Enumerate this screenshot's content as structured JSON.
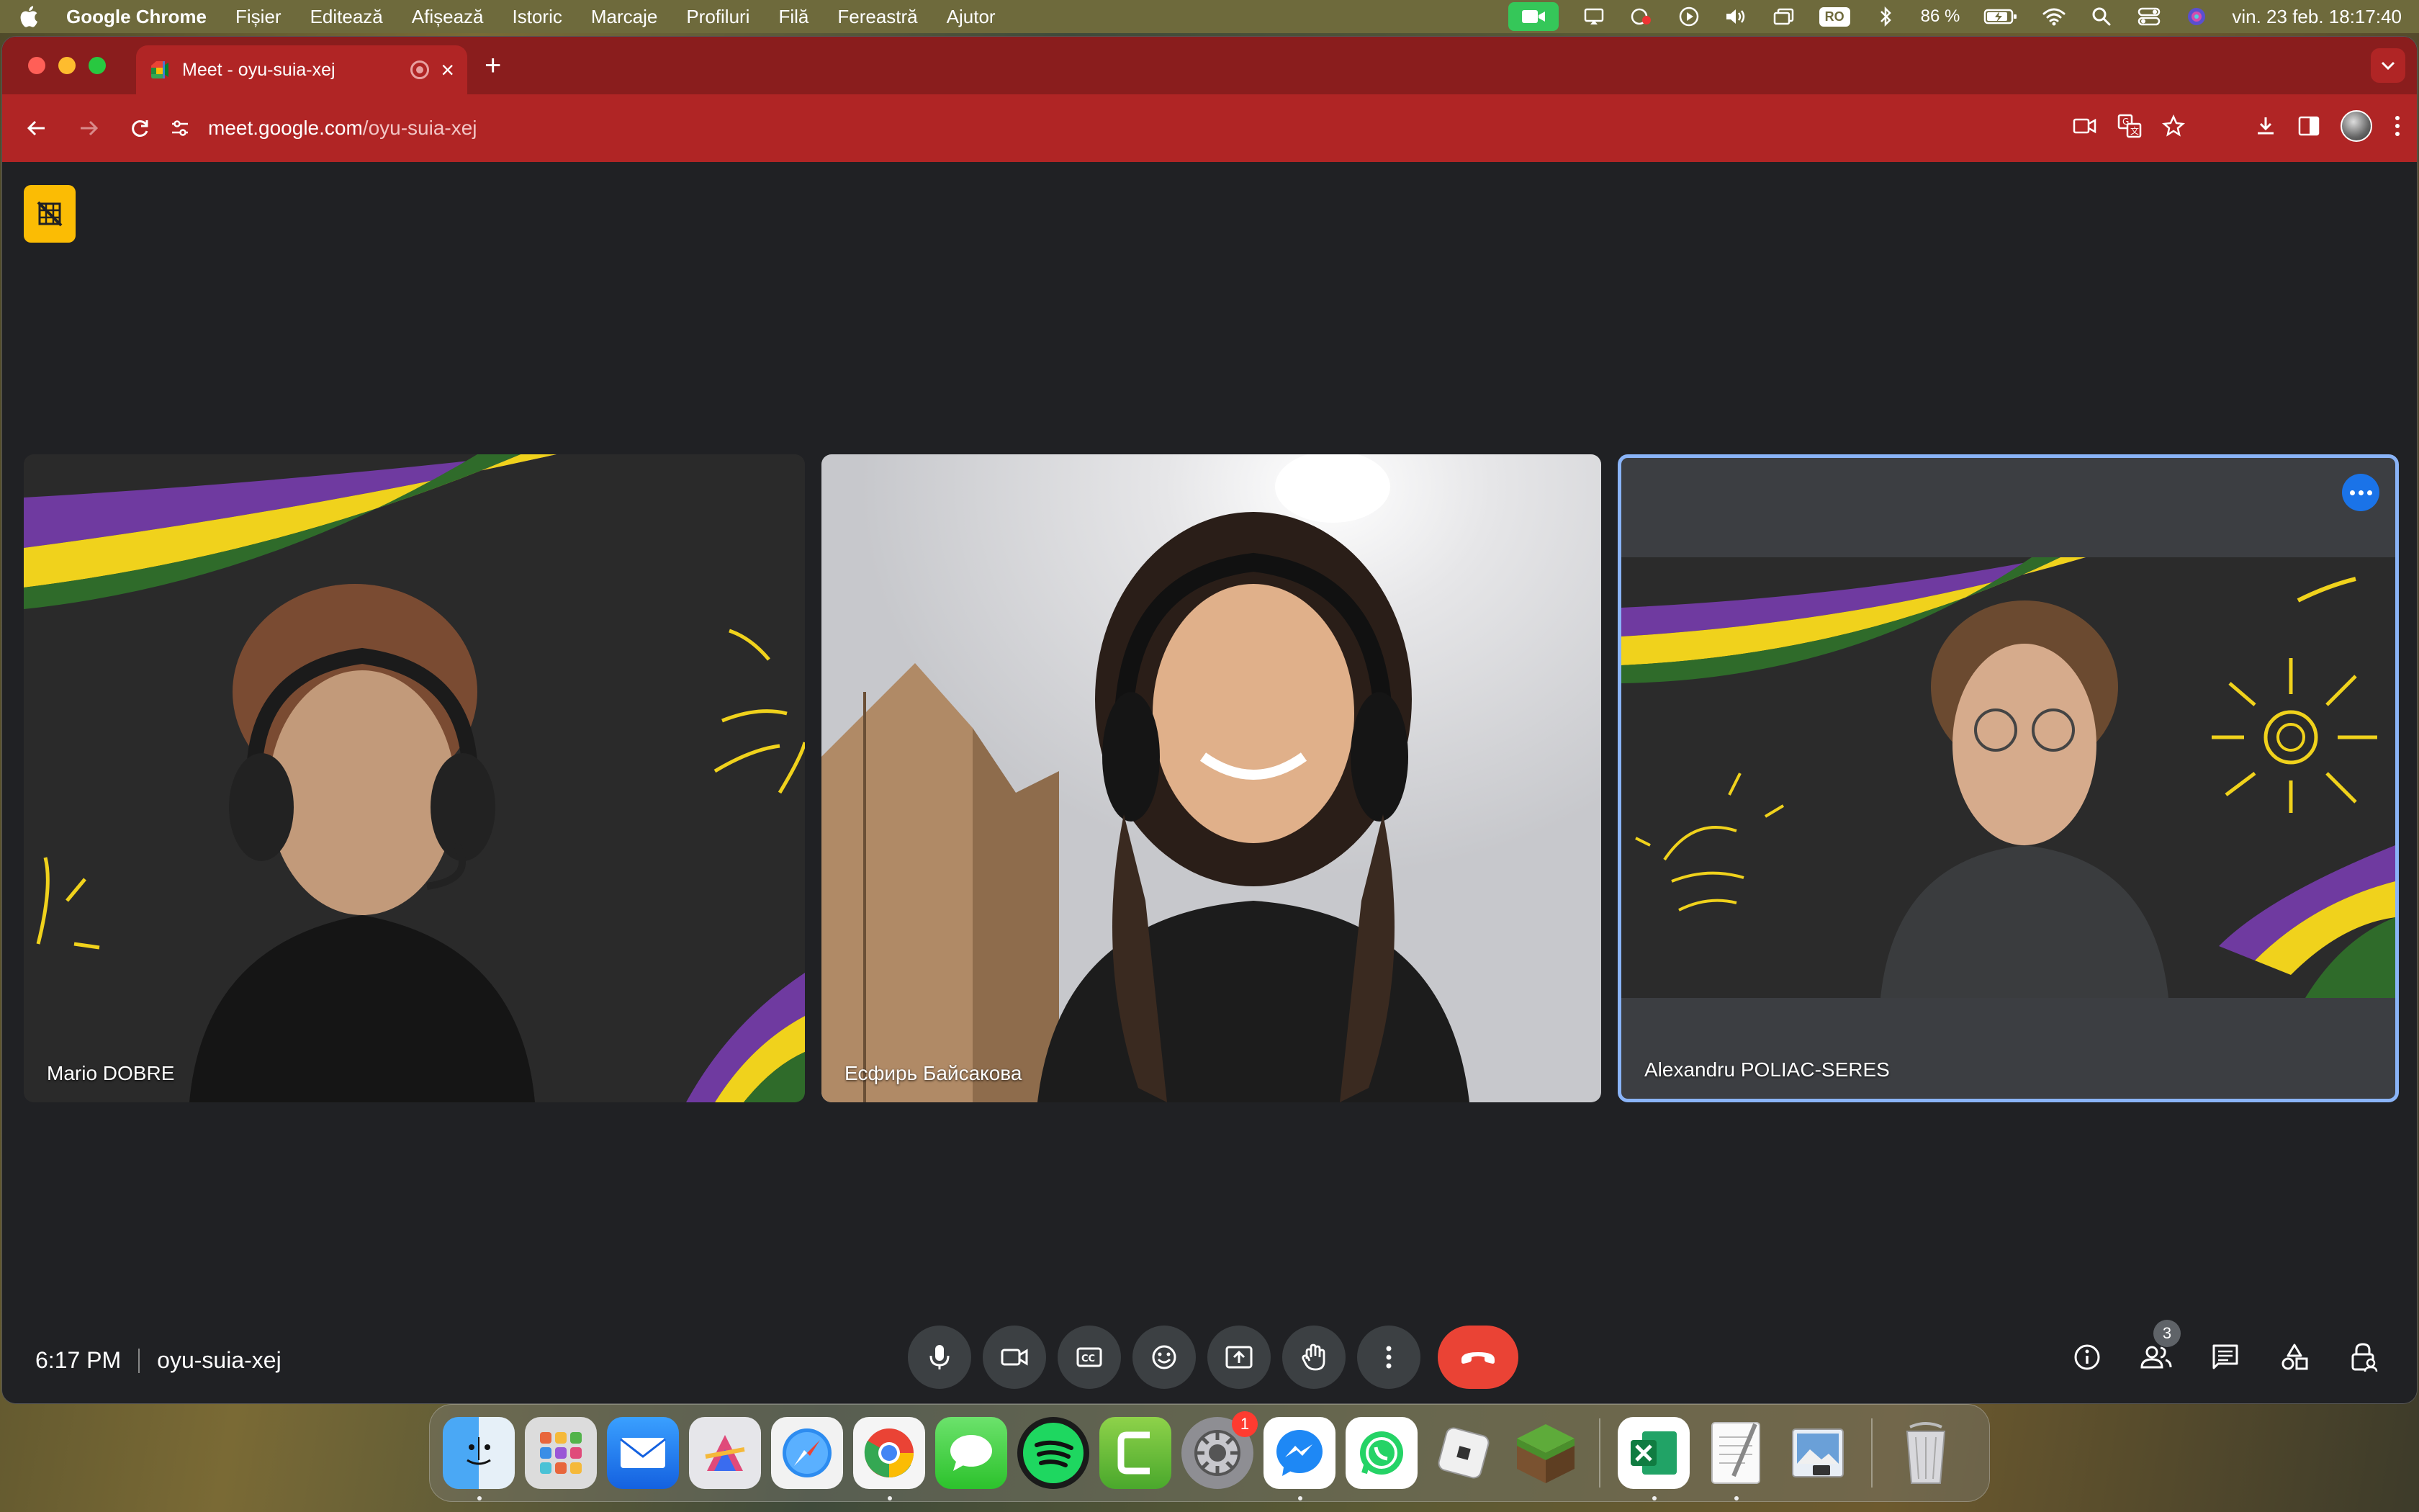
{
  "menubar": {
    "items": [
      "Google Chrome",
      "Fișier",
      "Editează",
      "Afișează",
      "Istoric",
      "Marcaje",
      "Profiluri",
      "Filă",
      "Fereastră",
      "Ajutor"
    ],
    "input_source": "RO",
    "battery": "86 %",
    "clock": "vin. 23 feb.  18:17:40"
  },
  "browser": {
    "tab_title": "Meet - oyu-suia-xej",
    "url_host": "meet.google.com",
    "url_path": "/oyu-suia-xej",
    "theme_color": "#b02525"
  },
  "meet": {
    "participants": [
      {
        "name": "Mario DOBRE"
      },
      {
        "name": "Есфирь Байсакова"
      },
      {
        "name": "Alexandru POLIAC-SERES"
      }
    ],
    "time": "6:17 PM",
    "meeting_code": "oyu-suia-xej",
    "participant_count": "3",
    "accent_color": "#8ab4f8",
    "end_call_color": "#ea4335"
  },
  "dock": {
    "apps": [
      "Finder",
      "Launchpad",
      "Mail",
      "Affinity",
      "Safari",
      "Chrome",
      "Messages",
      "Spotify",
      "Camtasia",
      "System Settings",
      "Messenger",
      "WhatsApp",
      "Roblox",
      "Minecraft",
      "Excel",
      "TextEdit",
      "Preview",
      "Trash"
    ],
    "settings_badge": "1"
  }
}
